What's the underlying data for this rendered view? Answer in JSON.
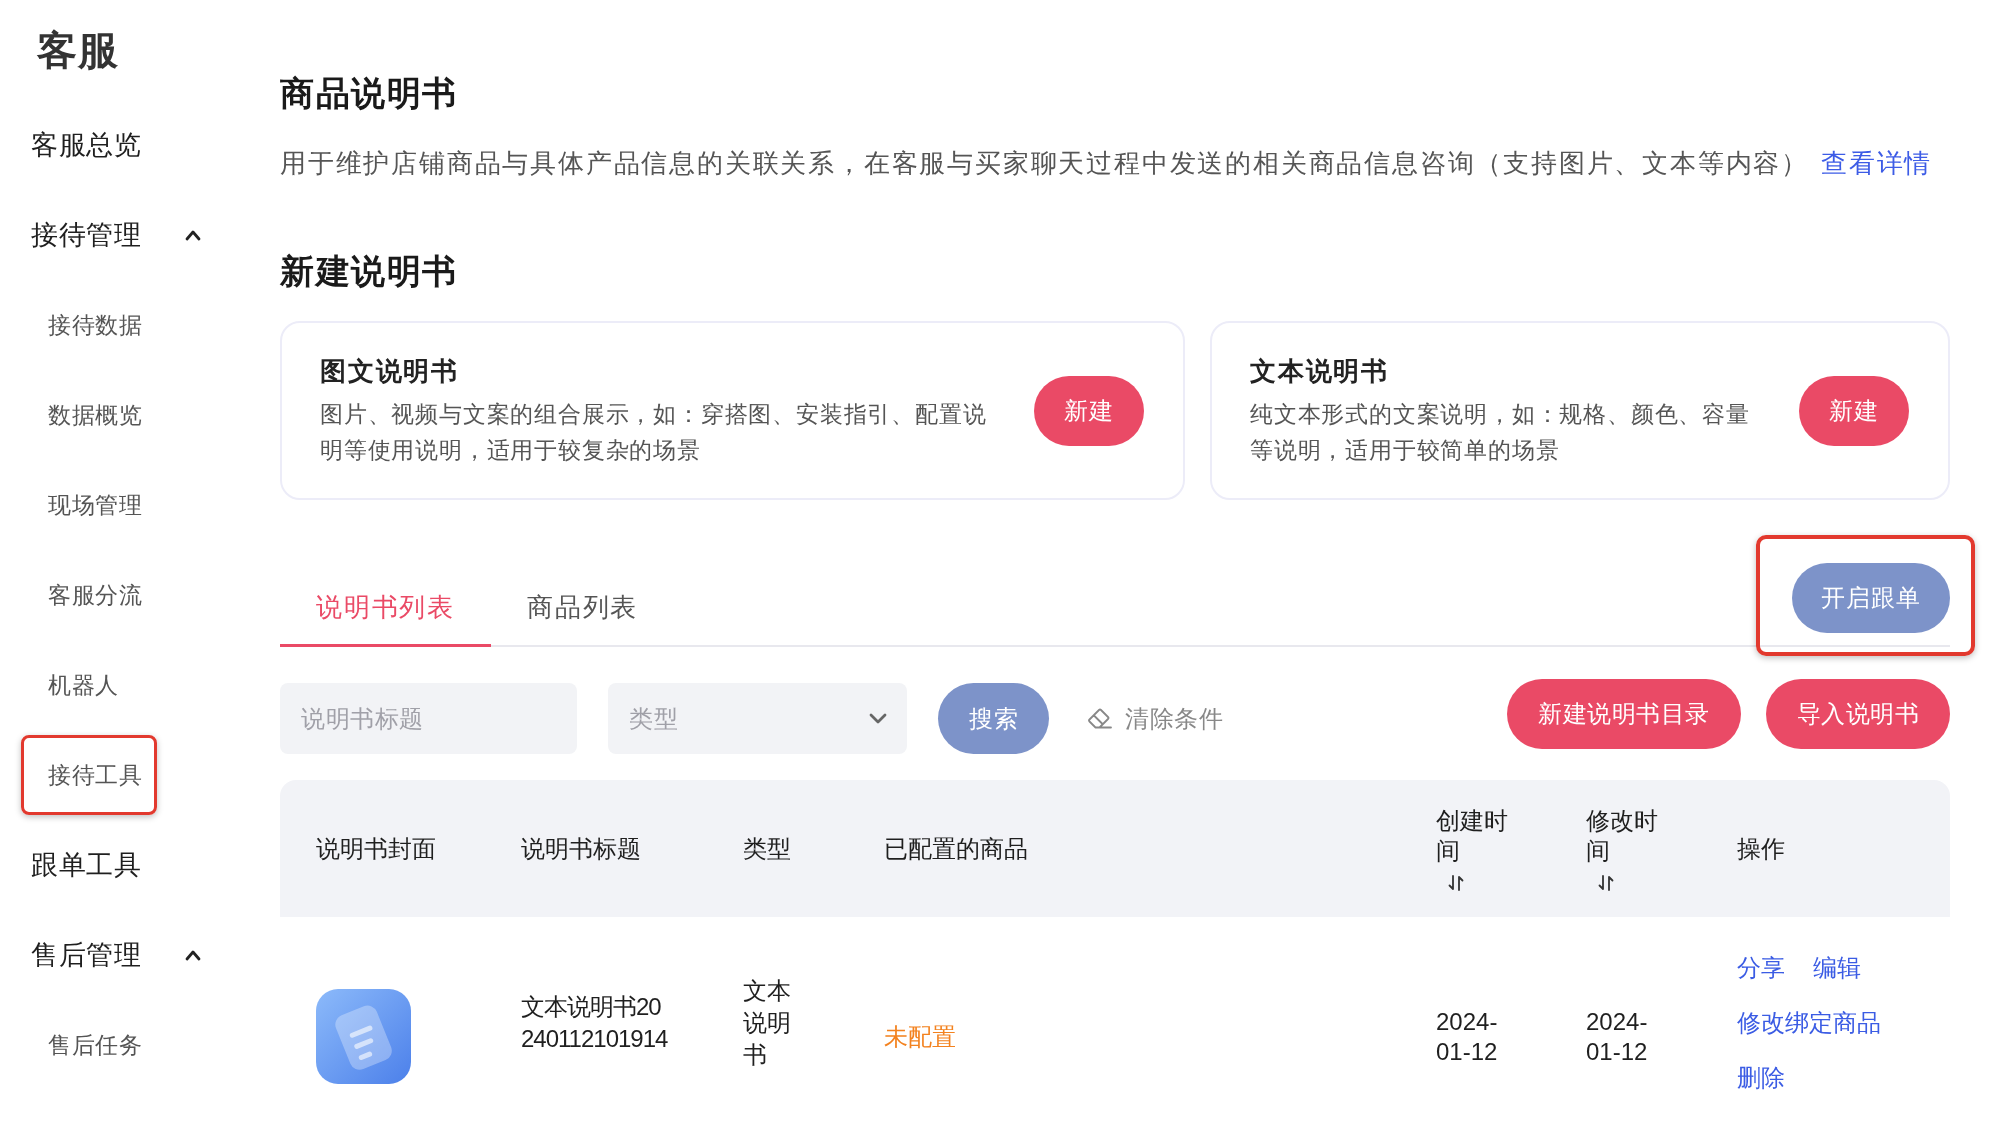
{
  "sidebar": {
    "title": "客服",
    "items": [
      {
        "kind": "link",
        "label": "客服总览"
      },
      {
        "kind": "group",
        "label": "接待管理",
        "expanded": true,
        "children": [
          {
            "label": "接待数据",
            "highlighted": false
          },
          {
            "label": "数据概览",
            "highlighted": false
          },
          {
            "label": "现场管理",
            "highlighted": false
          },
          {
            "label": "客服分流",
            "highlighted": false
          },
          {
            "label": "机器人",
            "highlighted": false
          },
          {
            "label": "接待工具",
            "highlighted": true
          }
        ]
      },
      {
        "kind": "link",
        "label": "跟单工具"
      },
      {
        "kind": "group",
        "label": "售后管理",
        "expanded": true,
        "children": [
          {
            "label": "售后任务",
            "highlighted": false
          }
        ]
      }
    ]
  },
  "page": {
    "title": "商品说明书",
    "description": "用于维护店铺商品与具体产品信息的关联关系，在客服与买家聊天过程中发送的相关商品信息咨询（支持图片、文本等内容）",
    "details_link": "查看详情"
  },
  "create_section": {
    "title": "新建说明书",
    "cards": [
      {
        "title": "图文说明书",
        "description": "图片、视频与文案的组合展示，如：穿搭图、安装指引、配置说明等使用说明，适用于较复杂的场景",
        "button": "新建"
      },
      {
        "title": "文本说明书",
        "description": "纯文本形式的文案说明，如：规格、颜色、容量等说明，适用于较简单的场景",
        "button": "新建"
      }
    ]
  },
  "tabs": [
    {
      "label": "说明书列表",
      "selected": true
    },
    {
      "label": "商品列表",
      "selected": false
    }
  ],
  "follow_button": {
    "label": "开启跟单",
    "highlighted": true
  },
  "filters": {
    "title_field": {
      "placeholder": "说明书标题"
    },
    "type_select": {
      "placeholder": "类型"
    },
    "search_button": "搜索",
    "clear_button": "清除条件"
  },
  "toolbar_buttons": [
    "新建说明书目录",
    "导入说明书"
  ],
  "table": {
    "columns": [
      {
        "label": "说明书封面",
        "sortable": false
      },
      {
        "label": "说明书标题",
        "sortable": false
      },
      {
        "label": "类型",
        "sortable": false
      },
      {
        "label": "已配置的商品",
        "sortable": false
      },
      {
        "label": "创建时间",
        "sortable": true
      },
      {
        "label": "修改时间",
        "sortable": true
      },
      {
        "label": "操作",
        "sortable": false
      }
    ],
    "rows": [
      {
        "title": "文本说明书20240112101914",
        "type": "文本说明书",
        "products": {
          "text": "未配置",
          "configured": false
        },
        "created": "2024-01-12",
        "modified": "2024-01-12",
        "actions": [
          "分享",
          "编辑",
          "修改绑定商品",
          "删除"
        ]
      }
    ]
  }
}
